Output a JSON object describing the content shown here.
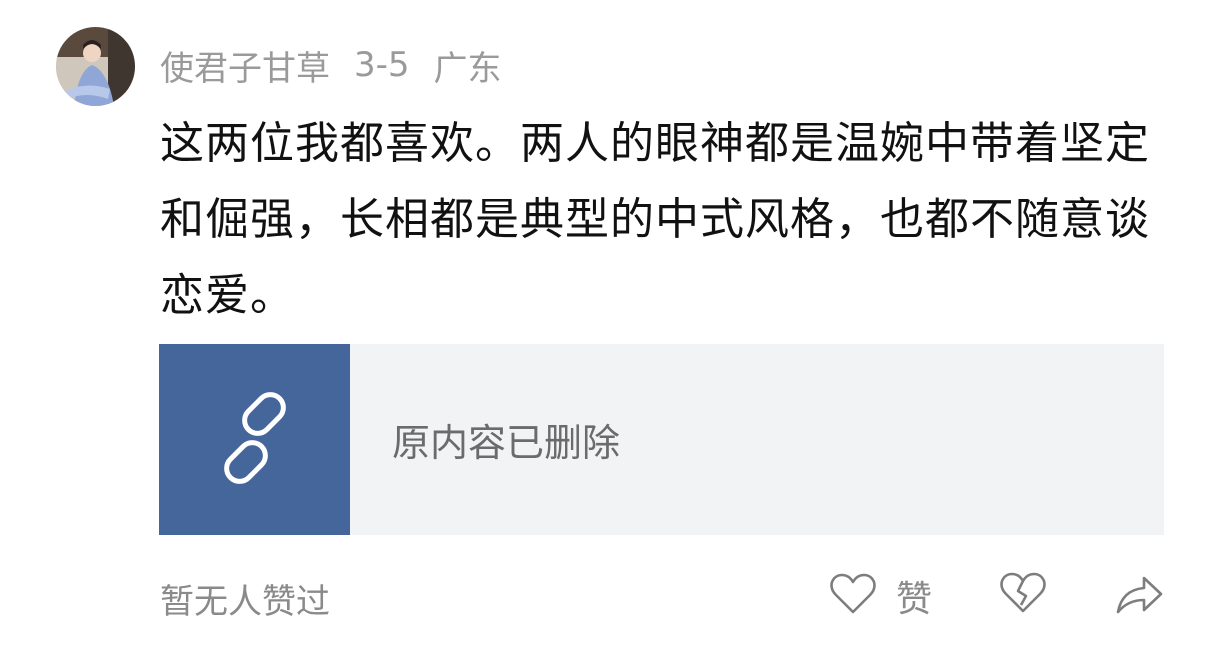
{
  "comment": {
    "username": "使君子甘草",
    "date": "3-5",
    "location": "广东",
    "text": "这两位我都喜欢。两人的眼神都是温婉中带着坚定和倔强，长相都是典型的中式风格，也都不随意谈恋爱。"
  },
  "quoted": {
    "status_text": "原内容已删除",
    "icon": "link-icon",
    "thumb_color": "#44669a"
  },
  "footer": {
    "likes_text": "暂无人赞过",
    "like_label": "赞",
    "like_icon": "heart-icon",
    "dislike_icon": "broken-heart-icon",
    "share_icon": "share-icon"
  }
}
